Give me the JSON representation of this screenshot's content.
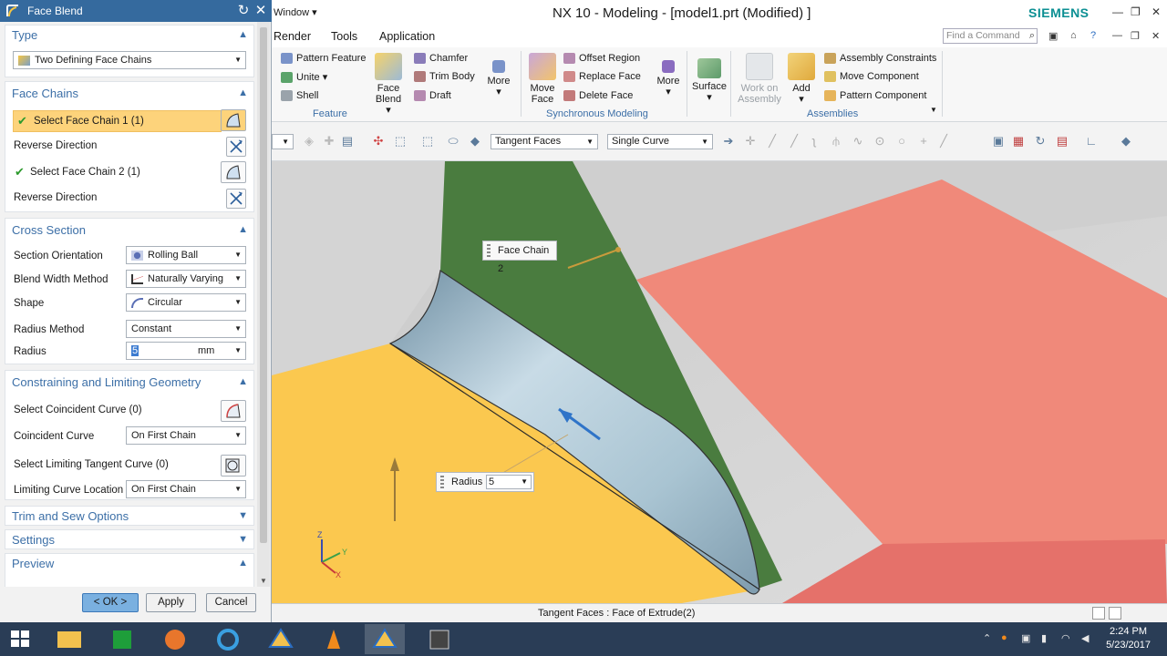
{
  "dialog": {
    "title": "Face Blend",
    "groups": {
      "type": {
        "header": "Type",
        "value": "Two Defining Face Chains"
      },
      "face_chains": {
        "header": "Face Chains",
        "select_chain_1": "Select Face Chain 1 (1)",
        "reverse_1": "Reverse Direction",
        "select_chain_2": "Select Face Chain 2 (1)",
        "reverse_2": "Reverse Direction"
      },
      "cross_section": {
        "header": "Cross Section",
        "rows": [
          {
            "label": "Section Orientation",
            "value": "Rolling Ball"
          },
          {
            "label": "Blend Width Method",
            "value": "Naturally Varying"
          },
          {
            "label": "Shape",
            "value": "Circular"
          },
          {
            "label": "Radius Method",
            "value": "Constant"
          }
        ],
        "radius_label": "Radius",
        "radius_value": "5",
        "radius_unit": "mm"
      },
      "constraining": {
        "header": "Constraining and Limiting Geometry",
        "select_coincident": "Select Coincident Curve (0)",
        "coincident_label": "Coincident Curve",
        "coincident_value": "On First Chain",
        "select_limiting": "Select Limiting Tangent Curve (0)",
        "limiting_label": "Limiting Curve Location",
        "limiting_value": "On First Chain"
      },
      "trim_sew": {
        "header": "Trim and Sew Options"
      },
      "settings": {
        "header": "Settings"
      },
      "preview": {
        "header": "Preview"
      }
    },
    "buttons": {
      "ok": "< OK >",
      "apply": "Apply",
      "cancel": "Cancel"
    }
  },
  "app": {
    "window_menu": "Window ▾",
    "title": "NX 10 - Modeling - [model1.prt (Modified) ]",
    "brand": "SIEMENS",
    "brand_color": "#0b8f93",
    "tabs": [
      "Render",
      "Tools",
      "Application"
    ],
    "search_placeholder": "Find a Command"
  },
  "ribbon": {
    "feature": {
      "label": "Feature",
      "items": [
        "Pattern Feature",
        "Unite",
        "Shell"
      ],
      "face_blend": "Face\nBlend",
      "items2": [
        "Chamfer",
        "Trim Body",
        "Draft"
      ],
      "more": "More"
    },
    "sync": {
      "label": "Synchronous Modeling",
      "move_face": "Move\nFace",
      "items": [
        "Offset Region",
        "Replace Face",
        "Delete Face"
      ],
      "more": "More"
    },
    "surface": "Surface",
    "assemblies": {
      "label": "Assemblies",
      "work_on": "Work on\nAssembly",
      "add": "Add",
      "items": [
        "Assembly Constraints",
        "Move Component",
        "Pattern Component"
      ]
    }
  },
  "toolbar2": {
    "filter1": "Tangent Faces",
    "filter2": "Single Curve"
  },
  "viewport": {
    "face_chain_label": "Face Chain 2",
    "radius_label": "Radius",
    "radius_value": "5",
    "axis_labels": {
      "z": "Z",
      "y": "Y",
      "x": "X"
    }
  },
  "status": {
    "text": "Tangent Faces : Face of Extrude(2)"
  },
  "taskbar": {
    "time": "2:24 PM",
    "date": "5/23/2017"
  },
  "colors": {
    "title_bar": "#356a9e",
    "group_header": "#3c6fa7",
    "selection_highlight": "#fdd37b",
    "face_yellow": "#fbc84f",
    "face_green": "#4a7c3f",
    "face_salmon": "#f0897a",
    "blend_surface": "#a9c4d2"
  }
}
